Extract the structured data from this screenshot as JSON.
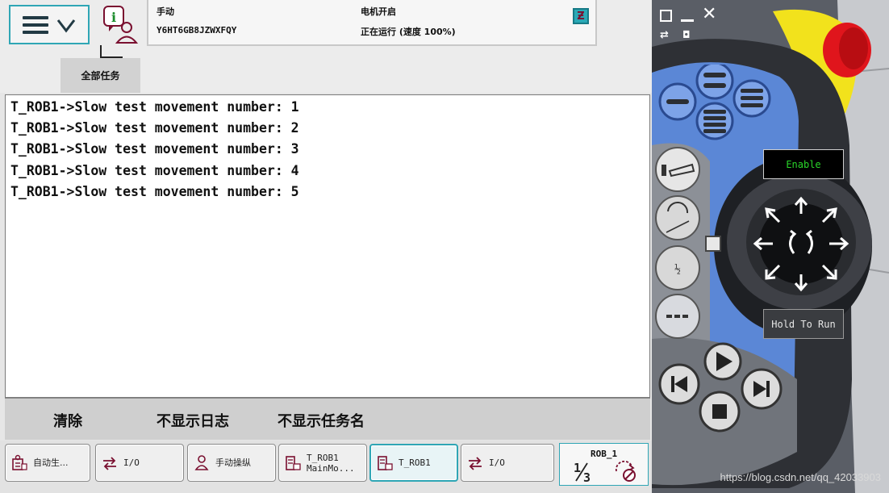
{
  "header": {
    "mode": "手动",
    "controller_name": "Y6HT6GB8JZWXFQY",
    "motor_state": "电机开启",
    "run_state": "正在运行 (速度 100%)"
  },
  "tabs": [
    {
      "label": "全部任务"
    }
  ],
  "log": {
    "lines": [
      "T_ROB1->Slow test movement number: 1",
      "T_ROB1->Slow test movement number: 2",
      "T_ROB1->Slow test movement number: 3",
      "T_ROB1->Slow test movement number: 4",
      "T_ROB1->Slow test movement number: 5"
    ]
  },
  "commands": {
    "clear": "清除",
    "hide_log": "不显示日志",
    "hide_task_name": "不显示任务名"
  },
  "taskbar": {
    "items": [
      {
        "label": "自动生...",
        "icon": "production-icon"
      },
      {
        "label": "I/O",
        "icon": "io-arrows-icon"
      },
      {
        "label": "手动操纵",
        "icon": "jogging-icon"
      },
      {
        "label": "T_ROB1",
        "label2": "MainMo...",
        "icon": "program-editor-icon"
      },
      {
        "label": "T_ROB1",
        "icon": "program-editor-icon",
        "active": true
      },
      {
        "label": "I/O",
        "icon": "io-arrows-icon"
      }
    ],
    "robot": {
      "name": "ROB_1",
      "fraction": "1/3"
    }
  },
  "pendant": {
    "enable_label": "Enable",
    "hold_to_run_label": "Hold To Run",
    "colors": {
      "accent": "#2fa6b5",
      "stop_button": "#e0151c",
      "guard_yellow": "#f2e21c",
      "blue_panel": "#5b87d6",
      "enable_text": "#29d629"
    }
  },
  "watermark": "https://blog.csdn.net/qq_42033903"
}
